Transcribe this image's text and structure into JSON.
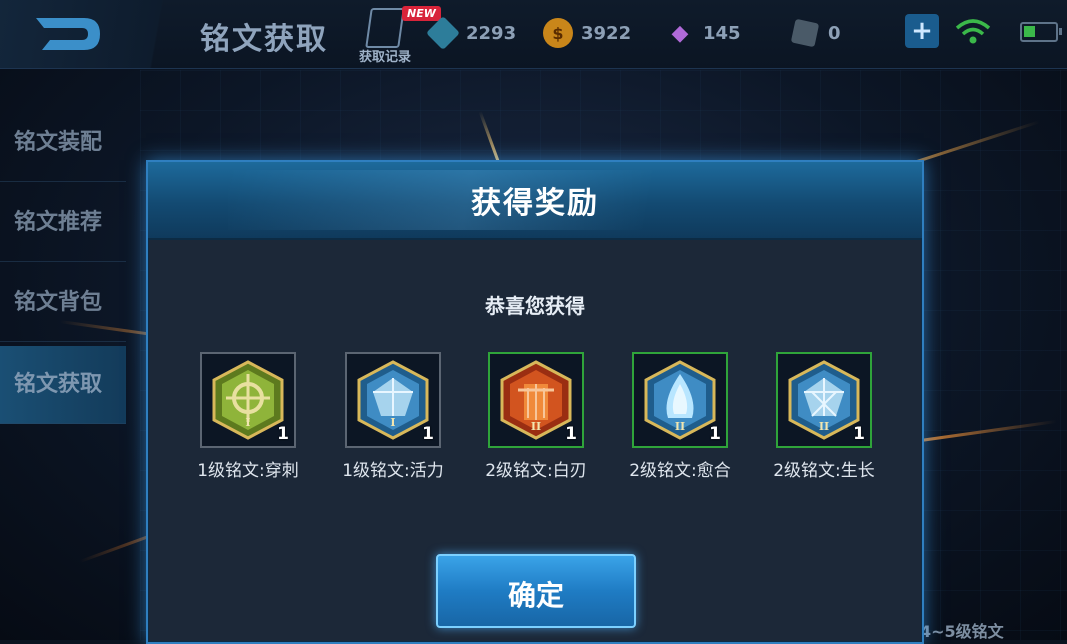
{
  "header": {
    "title": "铭文获取",
    "record_label": "获取记录",
    "new_badge": "NEW",
    "currencies": [
      {
        "icon": "cube-icon",
        "value": "2293",
        "color": "#3fa7c9"
      },
      {
        "icon": "coin-icon",
        "value": "3922",
        "color": "#e0a020"
      },
      {
        "icon": "diamond-icon",
        "value": "145",
        "color": "#b06ad8"
      },
      {
        "icon": "card-icon",
        "value": "0",
        "color": "#8a9aa8"
      }
    ],
    "plus_label": "+",
    "battery_level": 0.35
  },
  "sidebar": {
    "items": [
      {
        "label": "铭文装配",
        "active": false
      },
      {
        "label": "铭文推荐",
        "active": false
      },
      {
        "label": "铭文背包",
        "active": false
      },
      {
        "label": "铭文获取",
        "active": true
      }
    ]
  },
  "dialog": {
    "title": "获得奖励",
    "subtitle": "恭喜您获得",
    "rewards": [
      {
        "name": "1级铭文:穿刺",
        "count": "1",
        "level": "I",
        "color": "green",
        "icon": "inscription-pierce-icon"
      },
      {
        "name": "1级铭文:活力",
        "count": "1",
        "level": "I",
        "color": "blue",
        "icon": "inscription-vitality-icon"
      },
      {
        "name": "2级铭文:白刃",
        "count": "1",
        "level": "II",
        "color": "red",
        "icon": "inscription-blade-icon"
      },
      {
        "name": "2级铭文:愈合",
        "count": "1",
        "level": "II",
        "color": "blue",
        "icon": "inscription-heal-icon"
      },
      {
        "name": "2级铭文:生长",
        "count": "1",
        "level": "II",
        "color": "blue",
        "icon": "inscription-growth-icon"
      }
    ],
    "confirm_label": "确定"
  },
  "background_text": "4~5级铭文"
}
